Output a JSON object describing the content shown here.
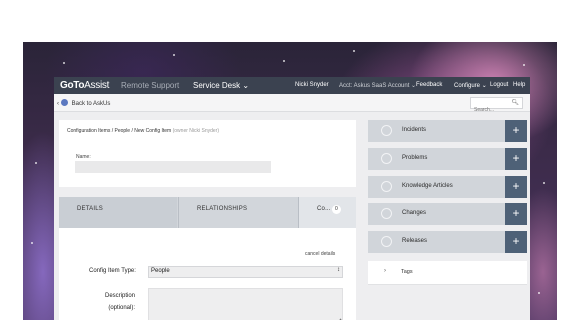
{
  "topnav": {
    "logo_bold": "GoTo",
    "logo_light": "Assist",
    "product_inactive": "Remote Support",
    "product_active": "Service Desk",
    "product_active_caret": "⌄",
    "user": "Nicki Snyder",
    "account": "Acct: Askus SaaS Account",
    "account_caret": "⌄",
    "feedback": "Feedback",
    "configure": "Configure",
    "configure_caret": "⌄",
    "logout": "Logout",
    "help": "Help"
  },
  "subbar": {
    "back_arrow": "‹",
    "back_icon": "askus-logo-icon",
    "back_label": "Back to",
    "back_target": "AskUs",
    "search_placeholder": "Search...",
    "search_icon": "search-icon"
  },
  "form": {
    "breadcrumb_path": "Configuration Items / People / New Config Item",
    "breadcrumb_owner": "(owner Nicki Snyder)",
    "name_label": "Name:",
    "name_value": ""
  },
  "tabs": [
    {
      "label": "DETAILS"
    },
    {
      "label": "RELATIONSHIPS"
    },
    {
      "label": "Co...",
      "count": "0"
    }
  ],
  "details": {
    "cancel_label": "cancel details",
    "ci_type_label": "Config Item Type:",
    "ci_type_value": "People",
    "ci_type_arrow": "↕",
    "description_label_line1": "Description",
    "description_label_line2": "(optional):",
    "description_value": ""
  },
  "sidebar": {
    "items": [
      {
        "label": "Incidents",
        "plus": "+"
      },
      {
        "label": "Problems",
        "plus": "+"
      },
      {
        "label": "Knowledge Articles",
        "plus": "+"
      },
      {
        "label": "Changes",
        "plus": "+"
      },
      {
        "label": "Releases",
        "plus": "+"
      }
    ],
    "tags": {
      "chevron": "›",
      "label": "Tags"
    }
  },
  "colors": {
    "nav_bg": "#3b4250",
    "plus_bg": "#4e6177",
    "sidebar_bg": "#d1d5da",
    "tab_bg": "#d2d6db"
  }
}
